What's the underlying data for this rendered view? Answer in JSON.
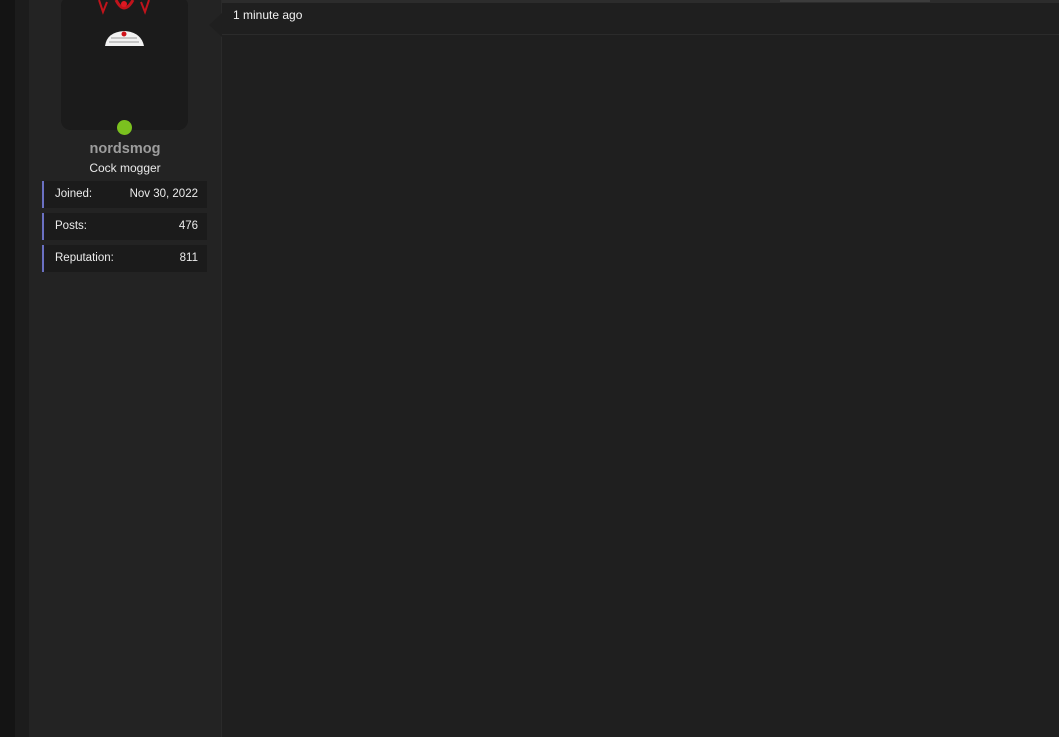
{
  "post": {
    "timestamp": "1 minute ago"
  },
  "user": {
    "username": "nordsmog",
    "title": "Cock mogger",
    "online": true,
    "online_color": "#7bc11f",
    "avatar_icon": "avatar-image",
    "stats": [
      {
        "label": "Joined:",
        "value": "Nov 30, 2022"
      },
      {
        "label": "Posts:",
        "value": "476"
      },
      {
        "label": "Reputation:",
        "value": "811"
      }
    ]
  },
  "colors": {
    "background": "#1f1f1f",
    "panel": "#232323",
    "stat_accent": "#6a70c2"
  }
}
